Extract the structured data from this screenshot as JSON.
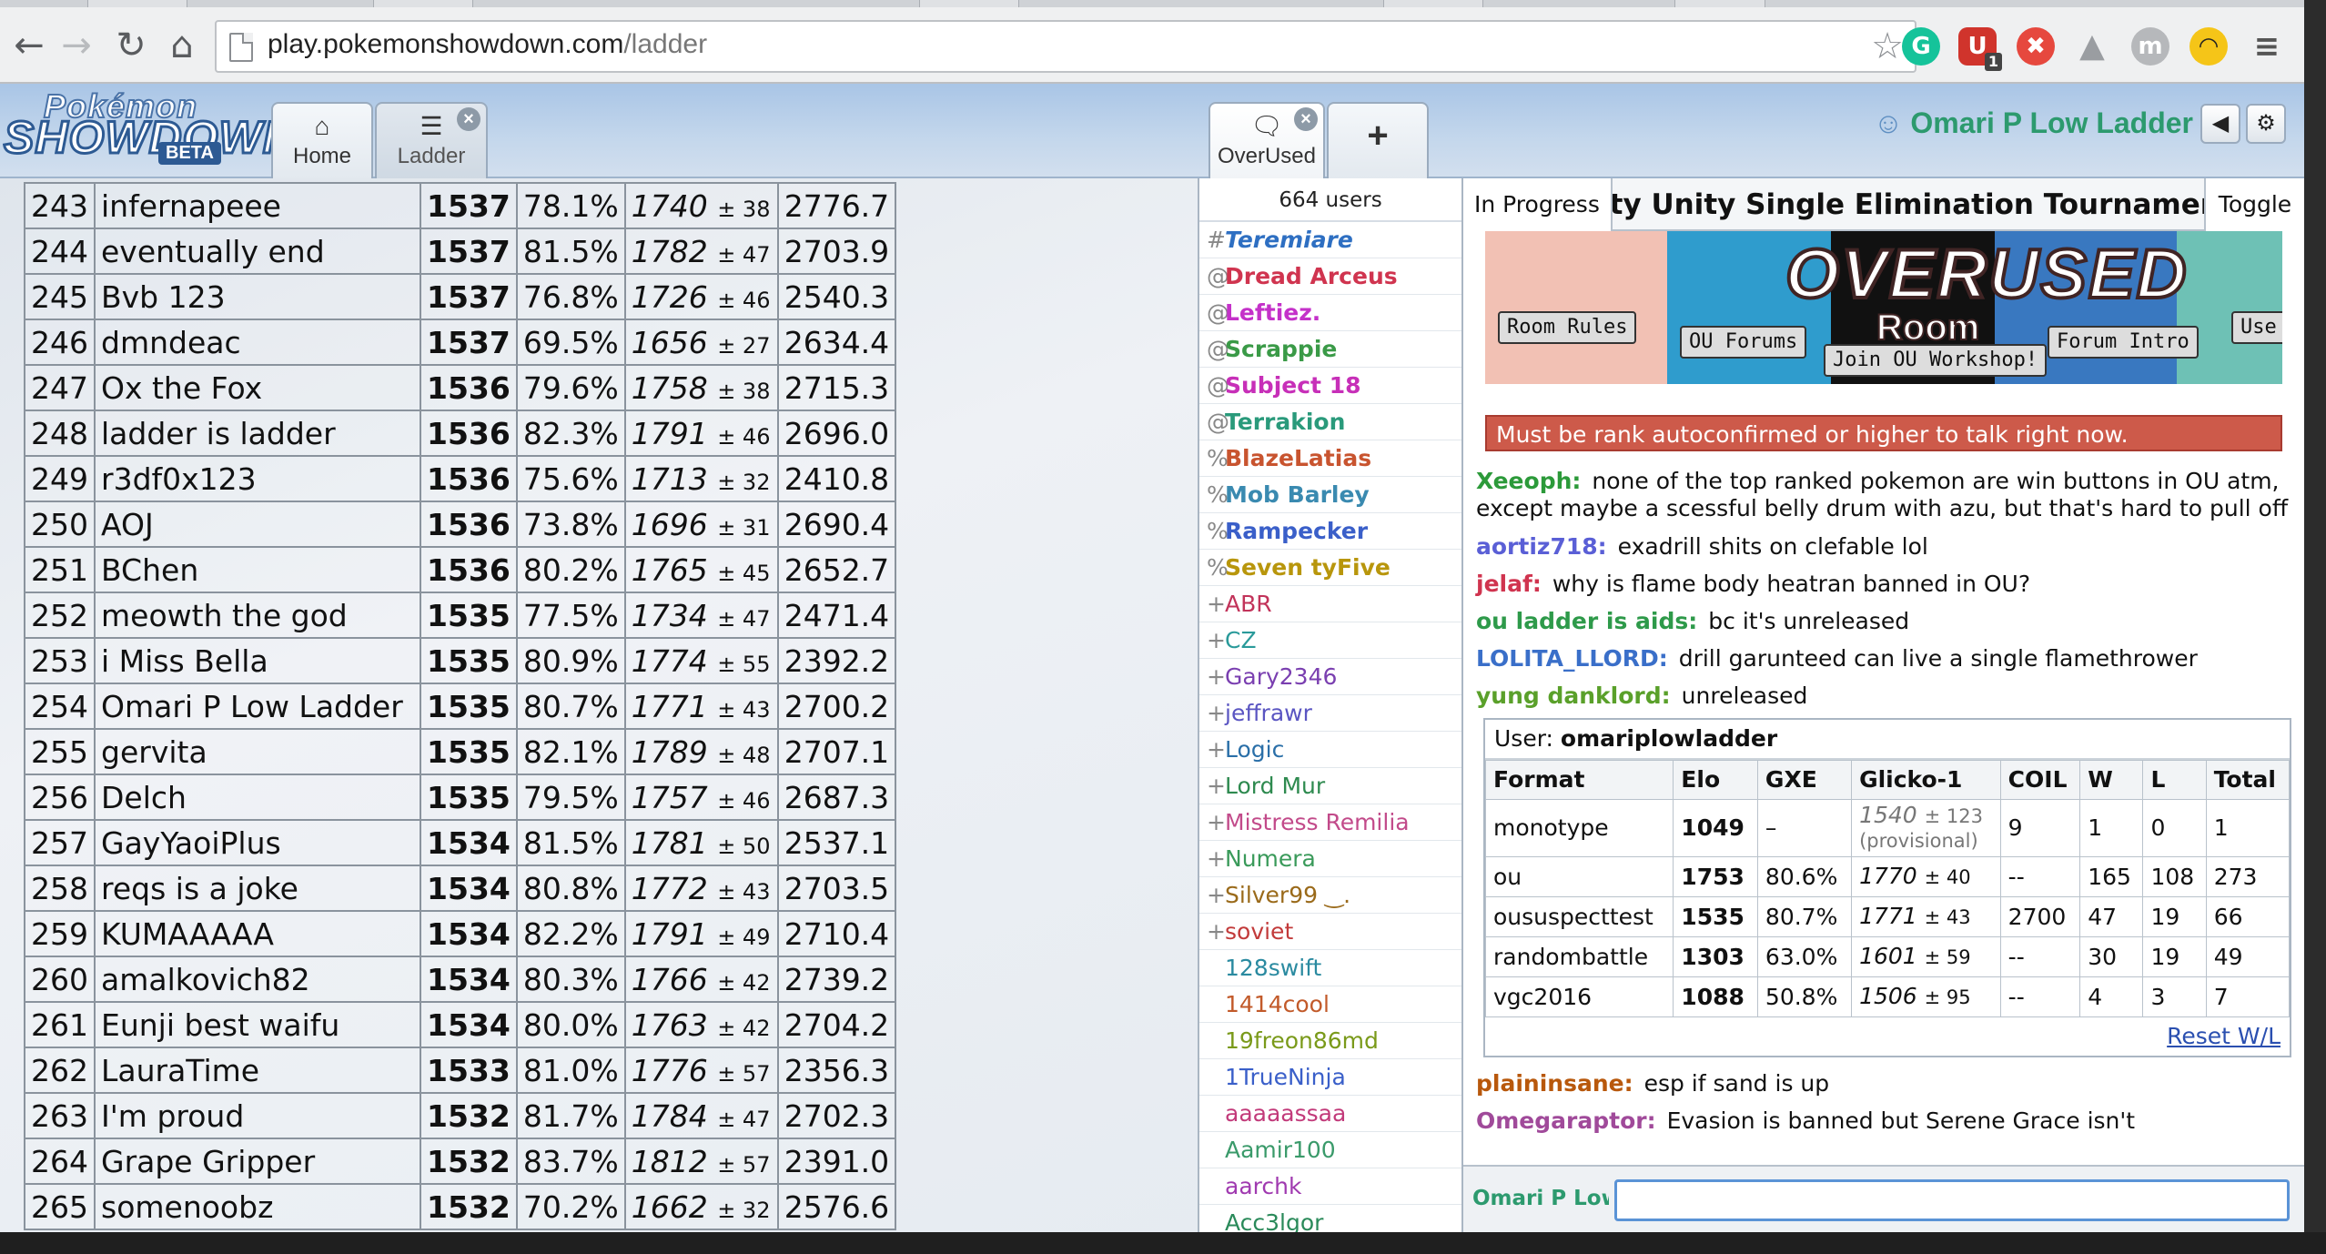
{
  "browser": {
    "url_host": "play.pokemonshowdown.com",
    "url_path": "/ladder",
    "icons": [
      "back-icon",
      "forward-icon",
      "reload-icon",
      "home-icon",
      "star-icon",
      "grammarly-icon",
      "ublock-icon",
      "lastpass-icon",
      "drive-icon",
      "profile-icon",
      "sunglasses-icon",
      "menu-icon"
    ],
    "ublock_badge": "1",
    "profile_letter": "m"
  },
  "header": {
    "logo_line1": "Pokémon",
    "logo_line2": "SHOWDOWN",
    "logo_line3": "BETA",
    "tabs": [
      {
        "label": "Home",
        "icon": "home-icon"
      },
      {
        "label": "Ladder",
        "icon": "list-icon"
      },
      {
        "label": "OverUsed",
        "icon": "chat-bubble-icon"
      }
    ],
    "add_tab": "+",
    "username": "Omari P Low Ladder",
    "sound_icon": "◀",
    "settings_icon": "⚙"
  },
  "ladder": {
    "rows": [
      [
        "243",
        "infernapeee",
        "1537",
        "78.1%",
        "1740",
        "± 38",
        "2776.7"
      ],
      [
        "244",
        "eventually end",
        "1537",
        "81.5%",
        "1782",
        "± 47",
        "2703.9"
      ],
      [
        "245",
        "Bvb 123",
        "1537",
        "76.8%",
        "1726",
        "± 46",
        "2540.3"
      ],
      [
        "246",
        "dmndeac",
        "1537",
        "69.5%",
        "1656",
        "± 27",
        "2634.4"
      ],
      [
        "247",
        "Ox the Fox",
        "1536",
        "79.6%",
        "1758",
        "± 38",
        "2715.3"
      ],
      [
        "248",
        "ladder is ladder",
        "1536",
        "82.3%",
        "1791",
        "± 46",
        "2696.0"
      ],
      [
        "249",
        "r3df0x123",
        "1536",
        "75.6%",
        "1713",
        "± 32",
        "2410.8"
      ],
      [
        "250",
        "AOJ",
        "1536",
        "73.8%",
        "1696",
        "± 31",
        "2690.4"
      ],
      [
        "251",
        "BChen",
        "1536",
        "80.2%",
        "1765",
        "± 45",
        "2652.7"
      ],
      [
        "252",
        "meowth the god",
        "1535",
        "77.5%",
        "1734",
        "± 47",
        "2471.4"
      ],
      [
        "253",
        "i Miss Bella",
        "1535",
        "80.9%",
        "1774",
        "± 55",
        "2392.2"
      ],
      [
        "254",
        "Omari P Low Ladder",
        "1535",
        "80.7%",
        "1771",
        "± 43",
        "2700.2"
      ],
      [
        "255",
        "gervita",
        "1535",
        "82.1%",
        "1789",
        "± 48",
        "2707.1"
      ],
      [
        "256",
        "Delch",
        "1535",
        "79.5%",
        "1757",
        "± 46",
        "2687.3"
      ],
      [
        "257",
        "GayYaoiPlus",
        "1534",
        "81.5%",
        "1781",
        "± 50",
        "2537.1"
      ],
      [
        "258",
        "reqs is a joke",
        "1534",
        "80.8%",
        "1772",
        "± 43",
        "2703.5"
      ],
      [
        "259",
        "KUMAAAAA",
        "1534",
        "82.2%",
        "1791",
        "± 49",
        "2710.4"
      ],
      [
        "260",
        "amalkovich82",
        "1534",
        "80.3%",
        "1766",
        "± 42",
        "2739.2"
      ],
      [
        "261",
        "Eunji best waifu",
        "1534",
        "80.0%",
        "1763",
        "± 42",
        "2704.2"
      ],
      [
        "262",
        "LauraTime",
        "1533",
        "81.0%",
        "1776",
        "± 57",
        "2356.3"
      ],
      [
        "263",
        "I'm proud",
        "1532",
        "81.7%",
        "1784",
        "± 47",
        "2702.3"
      ],
      [
        "264",
        "Grape Gripper",
        "1532",
        "83.7%",
        "1812",
        "± 57",
        "2391.0"
      ],
      [
        "265",
        "somenoobz",
        "1532",
        "70.2%",
        "1662",
        "± 32",
        "2576.6"
      ]
    ]
  },
  "userlist": {
    "count": "664 users",
    "users": [
      {
        "group": "#",
        "name": "Teremiare",
        "color": "#2e6fc2",
        "style": "bi"
      },
      {
        "group": "@",
        "name": "Dread Arceus",
        "color": "#d0344f",
        "style": "b"
      },
      {
        "group": "@",
        "name": "Leftiez.",
        "color": "#c431c9",
        "style": "b"
      },
      {
        "group": "@",
        "name": "Scrappie",
        "color": "#3a9a47",
        "style": "b"
      },
      {
        "group": "@",
        "name": "Subject 18",
        "color": "#c72fb8",
        "style": "b"
      },
      {
        "group": "@",
        "name": "Terrakion",
        "color": "#2a9a7b",
        "style": "b"
      },
      {
        "group": "%",
        "name": "BlazeLatias",
        "color": "#c8542f",
        "style": "b"
      },
      {
        "group": "%",
        "name": "Mob Barley",
        "color": "#3a8ab0",
        "style": "b"
      },
      {
        "group": "%",
        "name": "Rampecker",
        "color": "#3a5fc9",
        "style": "b"
      },
      {
        "group": "%",
        "name": "Seven tyFive",
        "color": "#b8960c",
        "style": "b"
      },
      {
        "group": "+",
        "name": "ABR",
        "color": "#c2335a",
        "style": ""
      },
      {
        "group": "+",
        "name": "CZ",
        "color": "#2a9a9a",
        "style": ""
      },
      {
        "group": "+",
        "name": "Gary2346",
        "color": "#7a3fb0",
        "style": ""
      },
      {
        "group": "+",
        "name": "jeffrawr",
        "color": "#5a55c2",
        "style": ""
      },
      {
        "group": "+",
        "name": "Logic",
        "color": "#2a6fa8",
        "style": ""
      },
      {
        "group": "+",
        "name": "Lord Mur",
        "color": "#2e8a4f",
        "style": ""
      },
      {
        "group": "+",
        "name": "Mistress Remilia",
        "color": "#c24a8a",
        "style": ""
      },
      {
        "group": "+",
        "name": "Numera",
        "color": "#3a9a5a",
        "style": ""
      },
      {
        "group": "+",
        "name": "Silver99 ‿.",
        "color": "#9a6a1a",
        "style": ""
      },
      {
        "group": "+",
        "name": "soviet",
        "color": "#c23a3a",
        "style": ""
      },
      {
        "group": "",
        "name": "128swift",
        "color": "#2a8aa0",
        "style": ""
      },
      {
        "group": "",
        "name": "1414cool",
        "color": "#c25a2a",
        "style": ""
      },
      {
        "group": "",
        "name": "19freon86md",
        "color": "#7a9a1a",
        "style": ""
      },
      {
        "group": "",
        "name": "1TrueNinja",
        "color": "#3a5fc9",
        "style": ""
      },
      {
        "group": "",
        "name": "aaaaassaa",
        "color": "#c23a7a",
        "style": ""
      },
      {
        "group": "",
        "name": "Aamir100",
        "color": "#3a9a6a",
        "style": ""
      },
      {
        "group": "",
        "name": "aarchk",
        "color": "#a03ab0",
        "style": ""
      },
      {
        "group": "",
        "name": "Acc3lgor",
        "color": "#2a8a5a",
        "style": ""
      }
    ]
  },
  "room": {
    "tour_status": "In Progress",
    "tour_title": "ity Unity Single Elimination Tournament",
    "tour_toggle": "Toggle",
    "banner_title": "OVERUSED",
    "banner_subtitle": "Room",
    "banner_buttons": [
      "Room Rules",
      "OU Forums",
      "Join OU Workshop!",
      "Forum Intro",
      "Use"
    ],
    "warning": "Must be rank autoconfirmed or higher to talk right now.",
    "chat_before": [
      {
        "who": "Xeeoph:",
        "msg": "none of the top ranked pokemon are win buttons in OU atm, except maybe a scessful belly drum with azu, but that's hard to pull off",
        "color": "#2c9a3a",
        "wrap": true
      },
      {
        "who": "aortiz718:",
        "msg": "exadrill shits on clefable lol",
        "color": "#5a5fd6",
        "wrap": false
      },
      {
        "who": "jelaf:",
        "msg": "why is flame body heatran banned in OU?",
        "color": "#d0344f",
        "wrap": false
      },
      {
        "who": "ou ladder is aids:",
        "msg": "bc it's unreleased",
        "color": "#2e9a4a",
        "wrap": false
      },
      {
        "who": "LOLITA_LLORD:",
        "msg": "drill garunteed can live a single flamethrower",
        "color": "#3a6fc9",
        "wrap": false
      },
      {
        "who": "yung danklord:",
        "msg": "unreleased",
        "color": "#5aa02a",
        "wrap": false
      }
    ],
    "userinfo": {
      "label": "User:",
      "name": "omariplowladder",
      "headers": [
        "Format",
        "Elo",
        "GXE",
        "Glicko-1",
        "COIL",
        "W",
        "L",
        "Total"
      ],
      "rows": [
        {
          "format": "monotype",
          "elo": "1049",
          "gxe": "–",
          "glicko": "1540",
          "dev": "± 123",
          "prov": "(provisional)",
          "coil": "9",
          "w": "1",
          "l": "0",
          "total": "1"
        },
        {
          "format": "ou",
          "elo": "1753",
          "gxe": "80.6%",
          "glicko": "1770",
          "dev": "± 40",
          "prov": "",
          "coil": "--",
          "w": "165",
          "l": "108",
          "total": "273"
        },
        {
          "format": "oususpecttest",
          "elo": "1535",
          "gxe": "80.7%",
          "glicko": "1771",
          "dev": "± 43",
          "prov": "",
          "coil": "2700",
          "w": "47",
          "l": "19",
          "total": "66"
        },
        {
          "format": "randombattle",
          "elo": "1303",
          "gxe": "63.0%",
          "glicko": "1601",
          "dev": "± 59",
          "prov": "",
          "coil": "--",
          "w": "30",
          "l": "19",
          "total": "49"
        },
        {
          "format": "vgc2016",
          "elo": "1088",
          "gxe": "50.8%",
          "glicko": "1506",
          "dev": "± 95",
          "prov": "",
          "coil": "--",
          "w": "4",
          "l": "3",
          "total": "7"
        }
      ],
      "reset": "Reset W/L"
    },
    "chat_after": [
      {
        "who": "plaininsane:",
        "msg": "esp if sand is up",
        "color": "#b8580c",
        "wrap": false
      },
      {
        "who": "Omegaraptor:",
        "msg": "Evasion is banned but Serene Grace isn't",
        "color": "#a04a9a",
        "wrap": false
      }
    ],
    "chat_name": "Omari P Low",
    "chat_input_value": ""
  }
}
